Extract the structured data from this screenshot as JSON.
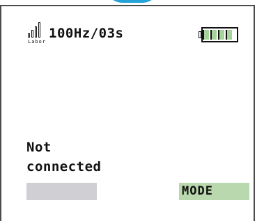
{
  "device": {
    "accent_color": "#25a3d8",
    "screen_border_color": "#4b4b4b"
  },
  "status_bar": {
    "signal_icon": "signal-strength-icon",
    "signal_label": "Labor",
    "sample_rate": "100Hz/03s",
    "battery_icon": "battery-icon",
    "battery_level": 1.0,
    "battery_color": "#a6d39b"
  },
  "main": {
    "connection_status": "Not\nconnected"
  },
  "softkeys": {
    "left_label": "",
    "left_color": "#cfcfd4",
    "right_label": "MODE",
    "right_color": "#b9d8ad"
  }
}
